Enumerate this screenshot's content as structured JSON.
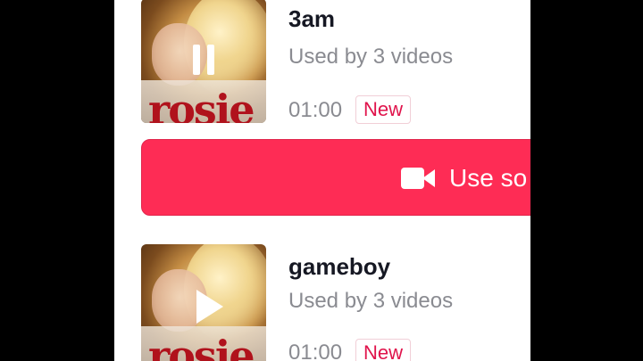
{
  "tracks": [
    {
      "title": "3am",
      "usage": "Used by 3 videos",
      "duration": "01:00",
      "badge": "New",
      "cover_wordmark": "rosie",
      "state": "playing"
    },
    {
      "title": "gameboy",
      "usage": "Used by 3 videos",
      "duration": "01:00",
      "badge": "New",
      "cover_wordmark": "rosie",
      "state": "paused"
    }
  ],
  "use_sound_button": {
    "label": "Use so",
    "icon": "video-camera-icon"
  },
  "colors": {
    "accent": "#fe2c55",
    "badge_text": "#e0144c",
    "secondary_text": "#8a8b91",
    "title_text": "#161823"
  }
}
